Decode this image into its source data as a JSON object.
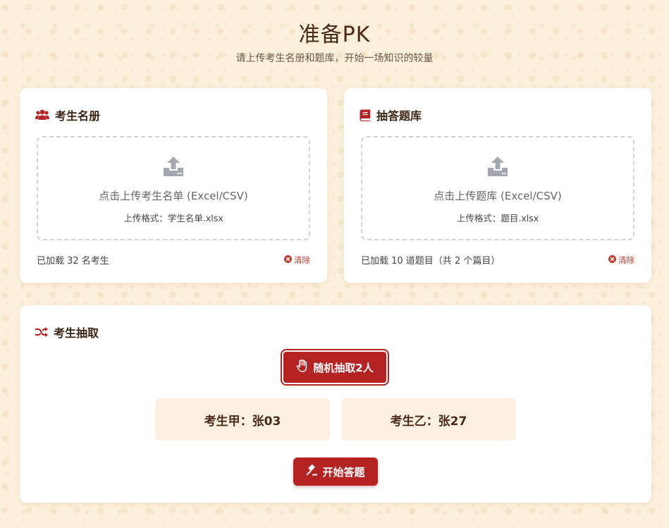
{
  "page": {
    "title": "准备PK",
    "subtitle": "请上传考生名册和题库，开始一场知识的较量"
  },
  "colors": {
    "accent": "#b52222",
    "heading": "#3b2414",
    "background": "#fbf0db",
    "result_bg": "#fbf0e1"
  },
  "roster": {
    "title": "考生名册",
    "icon": "users-icon",
    "upload_text": "点击上传考生名单 (Excel/CSV)",
    "format_hint": "上传格式：学生名单.xlsx",
    "status": "已加载 32 名考生",
    "clear_label": "清除"
  },
  "bank": {
    "title": "抽答题库",
    "icon": "book-icon",
    "upload_text": "点击上传题库 (Excel/CSV)",
    "format_hint": "上传格式：题目.xlsx",
    "status": "已加载 10 道题目（共 2 个篇目）",
    "clear_label": "清除"
  },
  "draw": {
    "title": "考生抽取",
    "icon": "shuffle-icon",
    "draw_button": "随机抽取2人",
    "result_a": "考生甲：张03",
    "result_b": "考生乙：张27",
    "start_button": "开始答题"
  }
}
